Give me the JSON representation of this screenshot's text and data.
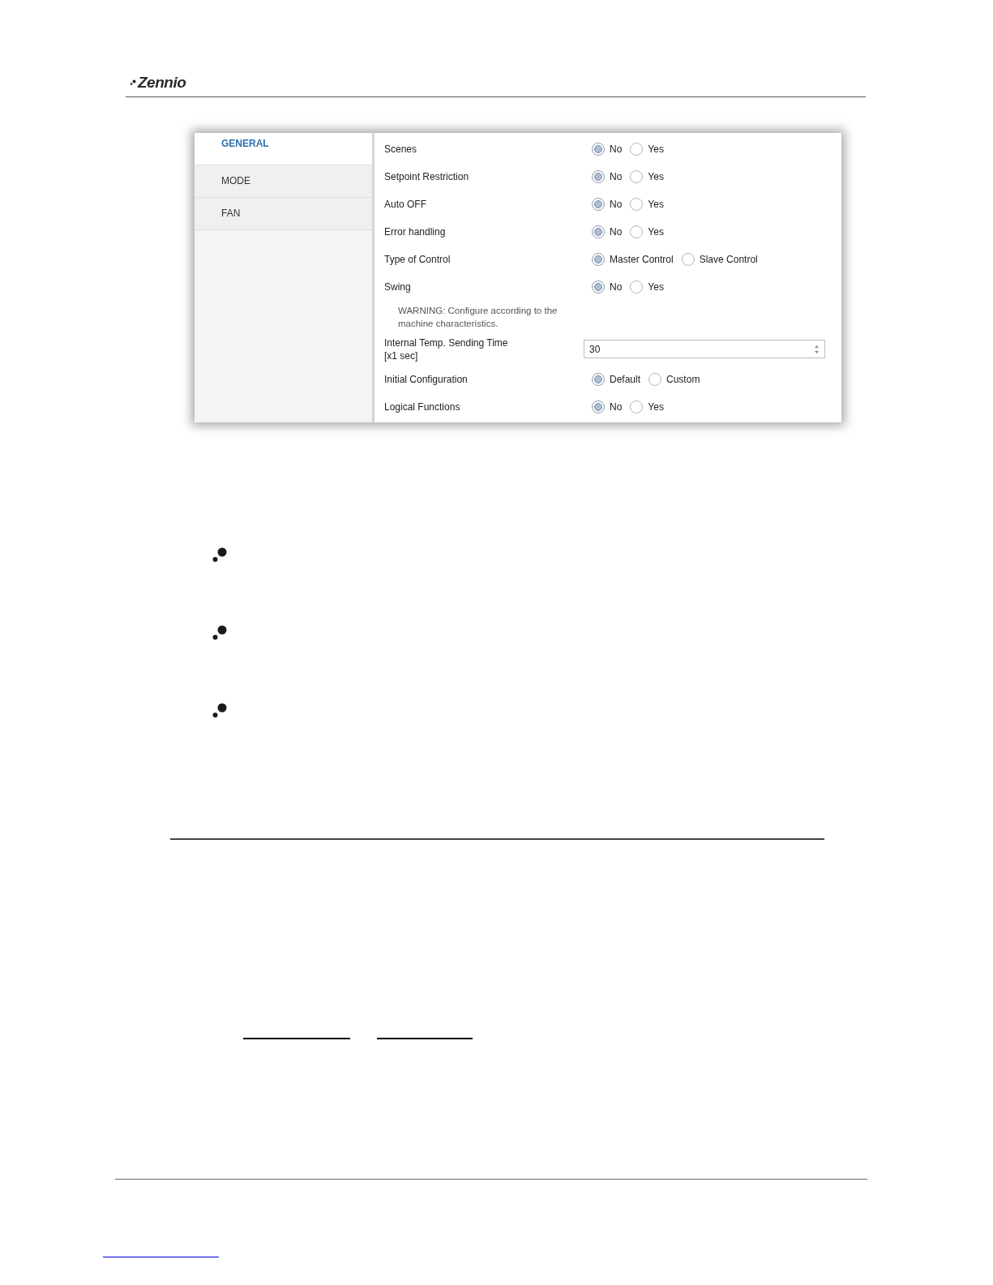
{
  "header": {
    "logo": "Zennio"
  },
  "settings": {
    "tabs": [
      {
        "label": "GENERAL",
        "selected": true
      },
      {
        "label": "MODE",
        "selected": false
      },
      {
        "label": "FAN",
        "selected": false
      }
    ],
    "rows": [
      {
        "kind": "radio",
        "label": "Scenes",
        "options": [
          {
            "label": "No",
            "selected": true
          },
          {
            "label": "Yes",
            "selected": false
          }
        ]
      },
      {
        "kind": "radio",
        "label": "Setpoint Restriction",
        "options": [
          {
            "label": "No",
            "selected": true
          },
          {
            "label": "Yes",
            "selected": false
          }
        ]
      },
      {
        "kind": "radio",
        "label": "Auto OFF",
        "options": [
          {
            "label": "No",
            "selected": true
          },
          {
            "label": "Yes",
            "selected": false
          }
        ]
      },
      {
        "kind": "radio",
        "label": "Error handling",
        "options": [
          {
            "label": "No",
            "selected": true
          },
          {
            "label": "Yes",
            "selected": false
          }
        ]
      },
      {
        "kind": "radio",
        "label": "Type of Control",
        "options": [
          {
            "label": "Master Control",
            "selected": true
          },
          {
            "label": "Slave Control",
            "selected": false
          }
        ]
      },
      {
        "kind": "radio",
        "label": "Swing",
        "options": [
          {
            "label": "No",
            "selected": true
          },
          {
            "label": "Yes",
            "selected": false
          }
        ]
      },
      {
        "kind": "note",
        "text": "WARNING: Configure according to the\nmachine characteristics."
      },
      {
        "kind": "number",
        "label": "Internal Temp. Sending Time\n[x1 sec]",
        "value": "30"
      },
      {
        "kind": "radio",
        "label": "Initial Configuration",
        "options": [
          {
            "label": "Default",
            "selected": true
          },
          {
            "label": "Custom",
            "selected": false
          }
        ]
      },
      {
        "kind": "radio",
        "label": "Logical Functions",
        "options": [
          {
            "label": "No",
            "selected": true
          },
          {
            "label": "Yes",
            "selected": false
          }
        ]
      }
    ]
  }
}
